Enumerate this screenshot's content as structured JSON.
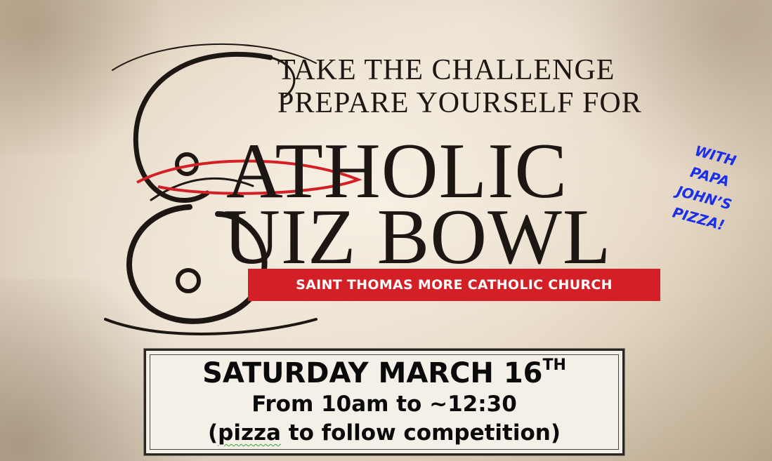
{
  "colors": {
    "paper": "#e8dccb",
    "ink": "#1c1712",
    "accent_red": "#d32027",
    "promo_blue": "#1a2fe8"
  },
  "header": {
    "line1": "TAKE THE CHALLENGE",
    "line2": "PREPARE YOURSELF FOR"
  },
  "title": {
    "word1": "ATHOLIC",
    "word2": "UIZ BOWL",
    "initial1": "C",
    "initial2": "Q"
  },
  "church_banner": {
    "text": "SAINT THOMAS MORE CATHOLIC CHURCH"
  },
  "promo": {
    "lines": [
      "WITH",
      "PAPA",
      "JOHN’S",
      "PIZZA!"
    ]
  },
  "event": {
    "date": "SATURDAY MARCH 16",
    "date_suffix": "TH",
    "time": "From 10am to ~12:30",
    "note_open": "(",
    "note_word": "pizza",
    "note_rest": " to follow competition)"
  },
  "icons": {
    "flourish": "calligraphic-c-q-flourish-icon"
  }
}
